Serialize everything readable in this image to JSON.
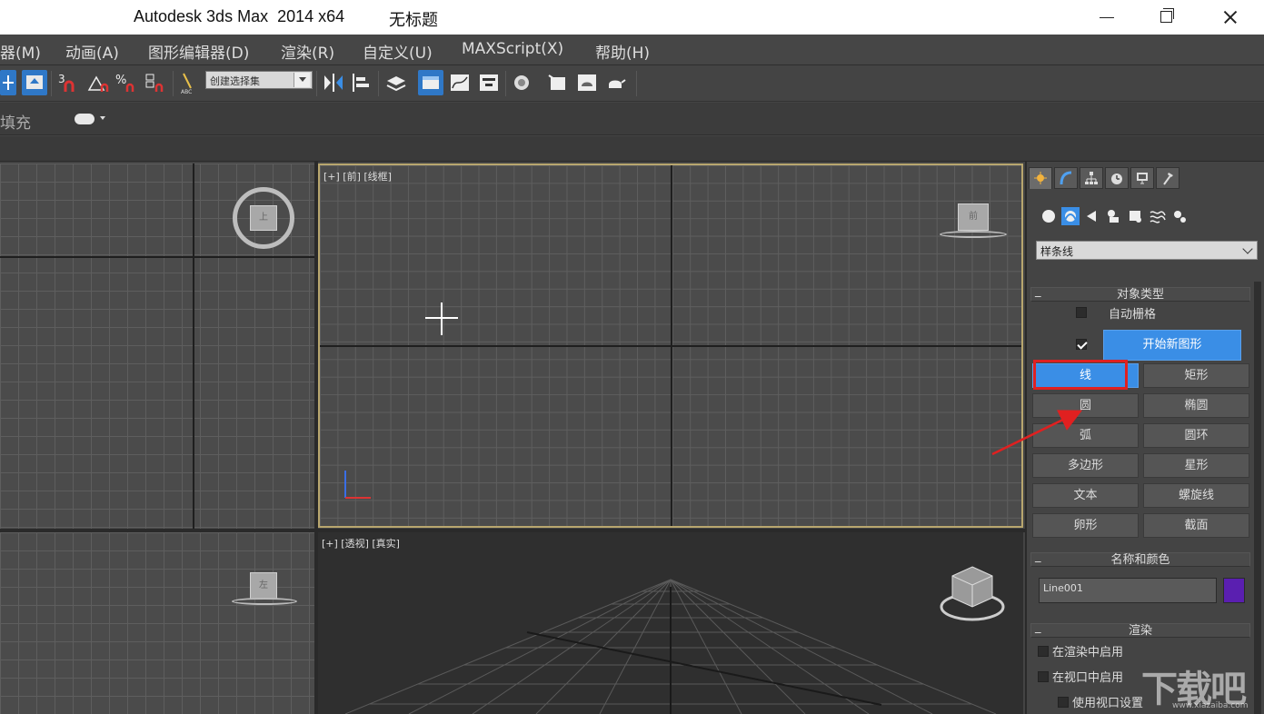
{
  "window": {
    "title": "Autodesk 3ds Max  2014 x64",
    "document": "无标题"
  },
  "menu": {
    "items": [
      "器(M)",
      "动画(A)",
      "图形编辑器(D)",
      "渲染(R)",
      "自定义(U)",
      "MAXScript(X)",
      "帮助(H)"
    ]
  },
  "toolbar": {
    "selection_set_placeholder": "创建选择集",
    "icons": [
      "move-icon",
      "select-region-icon",
      "snap-3d-icon",
      "angle-snap-icon",
      "percent-snap-icon",
      "spinner-snap-icon",
      "edit-named-selection-icon",
      "mirror-icon",
      "align-icon",
      "layer-manager-icon",
      "graphite-toggle-icon",
      "curve-editor-icon",
      "schematic-view-icon",
      "material-editor-icon",
      "render-setup-icon",
      "rendered-frame-icon",
      "render-production-icon"
    ]
  },
  "ribbon": {
    "label": "填充"
  },
  "viewports": {
    "front_label": "[+] [前] [线框]",
    "perspective_label": "[+] [透视] [真实]",
    "top_cube_label": "上",
    "front_cube_label": "前",
    "left_cube_label": "左"
  },
  "command_panel": {
    "tabs": [
      "create-tab",
      "modify-tab",
      "hierarchy-tab",
      "motion-tab",
      "display-tab",
      "utilities-tab"
    ],
    "category_icons": [
      "geometry-icon",
      "shapes-icon",
      "lights-icon",
      "cameras-icon",
      "helpers-icon",
      "spacewarps-icon",
      "systems-icon"
    ],
    "category_dropdown": "样条线",
    "object_type": {
      "title": "对象类型",
      "auto_grid_label": "自动栅格",
      "auto_grid_checked": false,
      "start_new_shape_checked": true,
      "start_new_shape_label": "开始新图形",
      "buttons": [
        {
          "label": "线",
          "active": true
        },
        {
          "label": "矩形",
          "active": false
        },
        {
          "label": "圆",
          "active": false
        },
        {
          "label": "椭圆",
          "active": false
        },
        {
          "label": "弧",
          "active": false
        },
        {
          "label": "圆环",
          "active": false
        },
        {
          "label": "多边形",
          "active": false
        },
        {
          "label": "星形",
          "active": false
        },
        {
          "label": "文本",
          "active": false
        },
        {
          "label": "螺旋线",
          "active": false
        },
        {
          "label": "卵形",
          "active": false
        },
        {
          "label": "截面",
          "active": false
        }
      ]
    },
    "name_color": {
      "title": "名称和颜色",
      "name_value": "Line001",
      "color": "#5a1fb0"
    },
    "rendering": {
      "title": "渲染",
      "enable_in_renderer": "在渲染中启用",
      "enable_in_viewport": "在视口中启用",
      "use_viewport_settings": "使用视口设置"
    }
  },
  "watermark": {
    "text": "下载吧",
    "url": "www.xiazaiba.com"
  },
  "colors": {
    "accent": "#3a8ee6",
    "highlight": "#e02020",
    "active_viewport_border": "#b8a66e"
  }
}
